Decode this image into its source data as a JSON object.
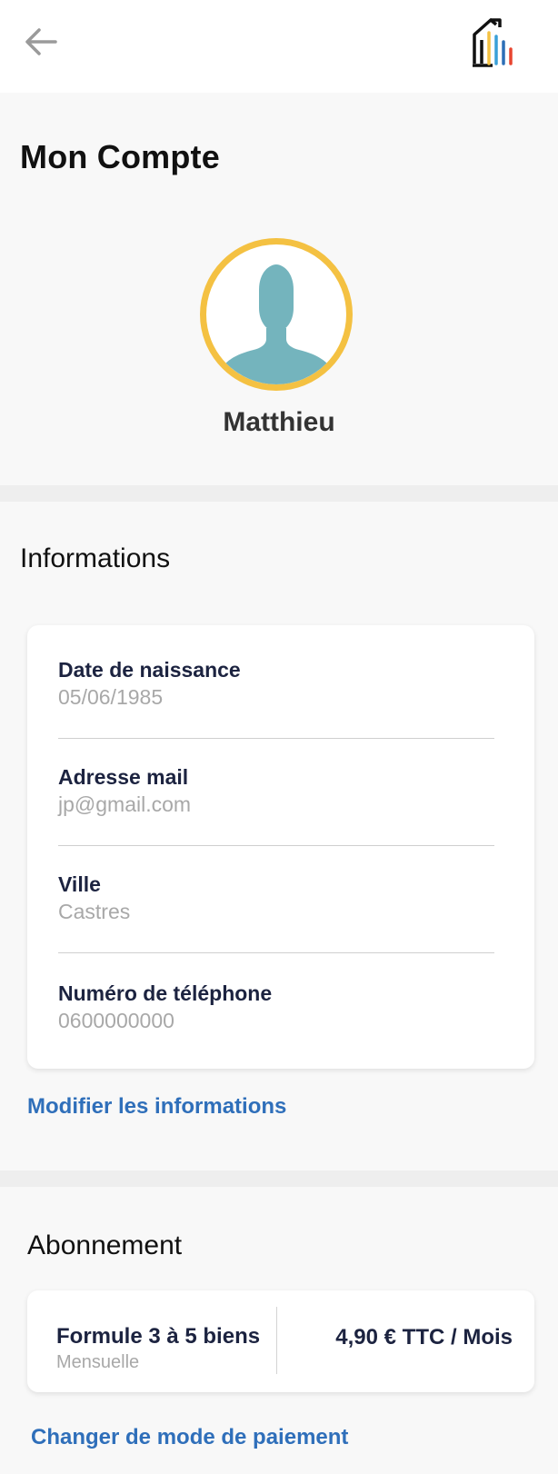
{
  "header": {
    "back_icon": "arrow-left-icon",
    "logo_icon": "house-bars-logo",
    "logo_colors": [
      "#111111",
      "#f4c142",
      "#3aa0d8",
      "#2c6fb6",
      "#e8452f"
    ]
  },
  "account": {
    "title": "Mon Compte",
    "avatar_icon": "user-silhouette-icon",
    "avatar_ring_color": "#f4c142",
    "avatar_figure_color": "#74b4bd",
    "name": "Matthieu"
  },
  "informations": {
    "title": "Informations",
    "fields": [
      {
        "label": "Date de naissance",
        "value": "05/06/1985"
      },
      {
        "label": "Adresse mail",
        "value": "jp@gmail.com"
      },
      {
        "label": "Ville",
        "value": "Castres"
      },
      {
        "label": "Numéro de téléphone",
        "value": "0600000000"
      }
    ],
    "edit_link": "Modifier les informations"
  },
  "subscription": {
    "title": "Abonnement",
    "plan_name": "Formule 3 à 5 biens",
    "plan_period": "Mensuelle",
    "price": "4,90 € TTC / Mois",
    "change_payment_link": "Changer de mode de paiement"
  },
  "colors": {
    "link": "#2f6fba",
    "label": "#1c2340",
    "value": "#a8a8a8"
  }
}
